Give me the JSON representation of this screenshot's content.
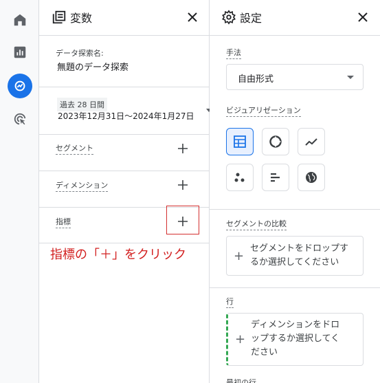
{
  "rail": {
    "items": [
      {
        "icon": "home-icon"
      },
      {
        "icon": "reports-icon"
      },
      {
        "icon": "explore-icon"
      },
      {
        "icon": "advertising-icon"
      }
    ],
    "accent": "#1a73e8"
  },
  "variables": {
    "title": "変数",
    "exploration_name_label": "データ探索名:",
    "exploration_name": "無題のデータ探索",
    "date_chip": "過去 28 日間",
    "date_range": "2023年12月31日～2024年1月27日",
    "segments_label": "セグメント",
    "dimensions_label": "ディメンション",
    "metrics_label": "指標"
  },
  "annotation": {
    "text": "指標の「＋」をクリック",
    "color": "#d21f1f"
  },
  "settings": {
    "title": "設定",
    "technique_label": "手法",
    "technique_value": "自由形式",
    "visualization_label": "ビジュアリゼーション",
    "visualizations": [
      {
        "icon": "table-icon",
        "selected": true
      },
      {
        "icon": "donut-chart-icon",
        "selected": false
      },
      {
        "icon": "line-chart-icon",
        "selected": false
      },
      {
        "icon": "scatter-plot-icon",
        "selected": false
      },
      {
        "icon": "bar-chart-icon",
        "selected": false
      },
      {
        "icon": "geo-map-icon",
        "selected": false
      }
    ],
    "segment_compare_label": "セグメントの比較",
    "segment_drop_line1": "セグメントをドロップす",
    "segment_drop_line2": "るか選択してください",
    "rows_label": "行",
    "rows_drop_line1": "ディメンションをドロ",
    "rows_drop_line2": "ップするか選択してく",
    "rows_drop_line3": "ださい",
    "first_row_label": "最初の行"
  }
}
